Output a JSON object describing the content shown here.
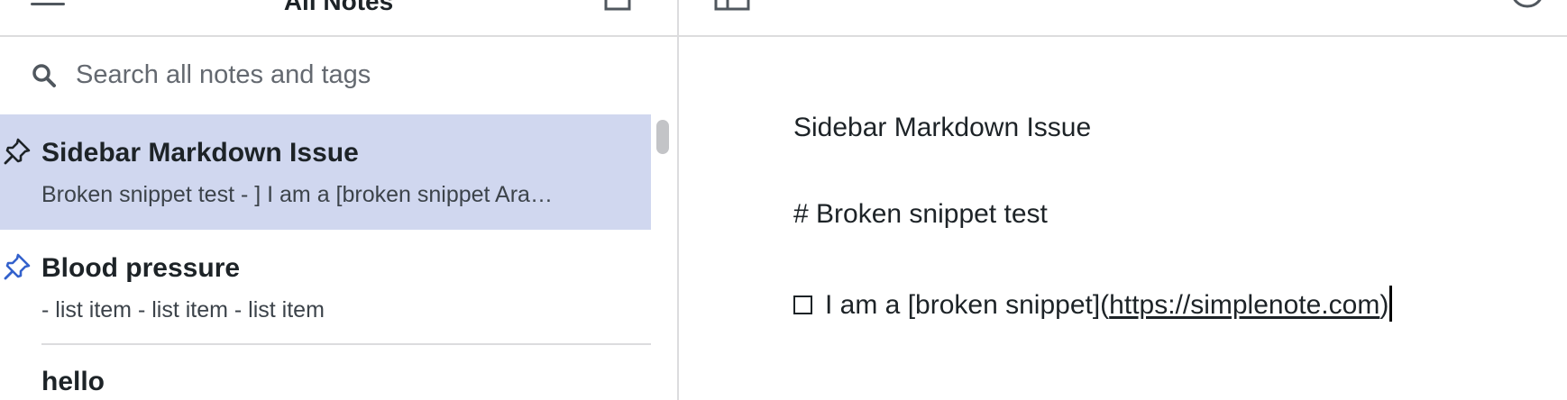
{
  "note_list": {
    "title": "All Notes",
    "search": {
      "placeholder": "Search all notes and tags",
      "value": ""
    },
    "notes": [
      {
        "title": "Sidebar Markdown Issue",
        "excerpt": "Broken snippet test - ] I am a [broken snippet Ara…",
        "pinned": true,
        "selected": true
      },
      {
        "title": "Blood pressure",
        "excerpt": "- list item - list item - list item",
        "pinned": true,
        "selected": false
      },
      {
        "title": "hello",
        "excerpt": "",
        "pinned": false,
        "selected": false
      }
    ]
  },
  "editor": {
    "line1": "Sidebar Markdown Issue",
    "line2": "# Broken snippet test",
    "line3_text": "I am a [broken snippet]",
    "line3_link_open": "(",
    "line3_link": "https://simplenote.com",
    "line3_link_close": ")"
  },
  "icons": {
    "menu": "hamburger-menu-icon",
    "new_note": "new-note-icon",
    "search": "search-icon",
    "pin": "pin-icon",
    "sidebar_toggle": "sidebar-toggle-icon",
    "info": "info-icon",
    "checkbox": "checkbox-icon"
  },
  "colors": {
    "selected_row": "#d0d7ef",
    "pin_selected": "#1d2327",
    "pin_accent": "#3361cc",
    "divider": "#dcdcde",
    "text": "#1d2327",
    "muted_text": "#646970"
  }
}
